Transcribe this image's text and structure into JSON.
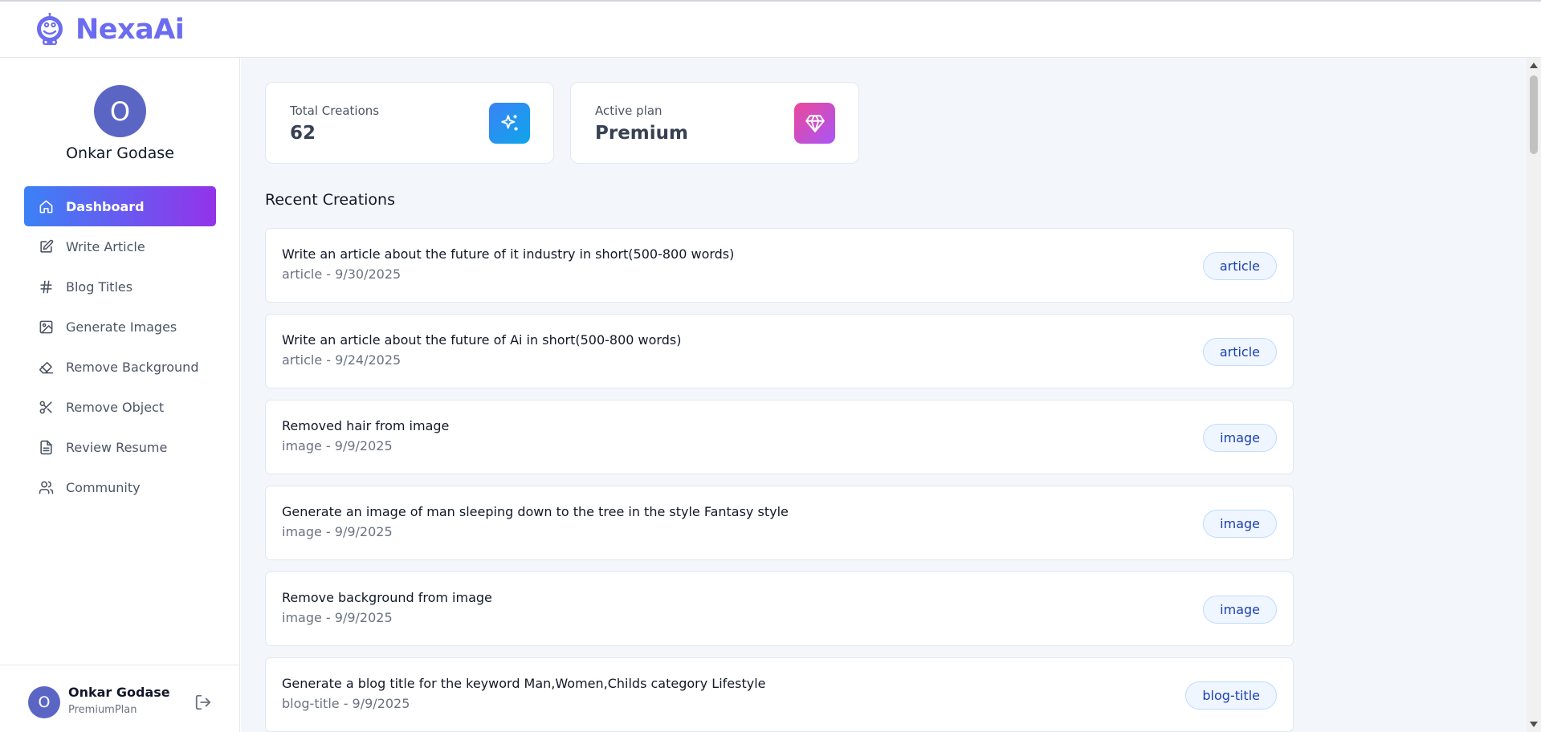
{
  "app": {
    "name": "NexaAi",
    "accent": "#6b6cf0"
  },
  "user": {
    "initial": "O",
    "name": "Onkar Godase",
    "plan": "PremiumPlan"
  },
  "sidebar": {
    "items": [
      {
        "label": "Dashboard",
        "icon": "home-icon",
        "active": true
      },
      {
        "label": "Write Article",
        "icon": "edit-icon"
      },
      {
        "label": "Blog Titles",
        "icon": "hash-icon"
      },
      {
        "label": "Generate Images",
        "icon": "image-icon"
      },
      {
        "label": "Remove Background",
        "icon": "eraser-icon"
      },
      {
        "label": "Remove Object",
        "icon": "scissors-icon"
      },
      {
        "label": "Review Resume",
        "icon": "file-text-icon"
      },
      {
        "label": "Community",
        "icon": "users-icon"
      }
    ],
    "active_gradient": [
      "#3b82f6",
      "#9333ea"
    ]
  },
  "stats": {
    "total": {
      "label": "Total Creations",
      "value": "62",
      "icon": "sparkles-icon",
      "color": "#2196f3"
    },
    "plan": {
      "label": "Active plan",
      "value": "Premium",
      "icon": "gem-icon",
      "color": "#d946ef"
    }
  },
  "recent": {
    "title": "Recent Creations",
    "items": [
      {
        "prompt": "Write an article about the future of it industry in short(500-800 words)",
        "meta": "article - 9/30/2025",
        "type": "article"
      },
      {
        "prompt": "Write an article about the future of Ai in short(500-800 words)",
        "meta": "article - 9/24/2025",
        "type": "article"
      },
      {
        "prompt": "Removed hair from image",
        "meta": "image - 9/9/2025",
        "type": "image"
      },
      {
        "prompt": "Generate an image of man sleeping down to the tree in the style Fantasy style",
        "meta": "image - 9/9/2025",
        "type": "image"
      },
      {
        "prompt": "Remove background from image",
        "meta": "image - 9/9/2025",
        "type": "image"
      },
      {
        "prompt": "Generate a blog title for the keyword Man,Women,Childs category Lifestyle",
        "meta": "blog-title - 9/9/2025",
        "type": "blog-title"
      }
    ]
  }
}
